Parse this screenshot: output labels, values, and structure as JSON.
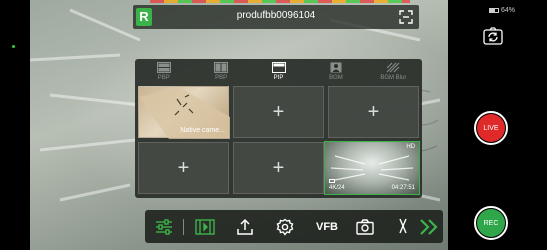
{
  "topbar": {
    "title": "produfbb0096104",
    "badge": "R"
  },
  "layout_tabs": [
    {
      "label": "PBP",
      "active": false
    },
    {
      "label": "PBP",
      "active": false
    },
    {
      "label": "PIP",
      "active": true
    },
    {
      "label": "BGM",
      "active": false
    },
    {
      "label": "BGM Blur",
      "active": false
    }
  ],
  "grid": {
    "camera_caption": "Native came...",
    "plus": "+",
    "preview": {
      "quality": "HD",
      "resolution": "4K/24",
      "timecode": "04:27:51"
    }
  },
  "toolbar": {
    "vfb_label": "VFB"
  },
  "status": {
    "battery": "64%"
  },
  "buttons": {
    "live": "LIVE",
    "rec": "REC"
  },
  "colors": {
    "accent_green": "#3cb34a",
    "live_red": "#e02a2a",
    "rec_green": "#2fa64a"
  }
}
